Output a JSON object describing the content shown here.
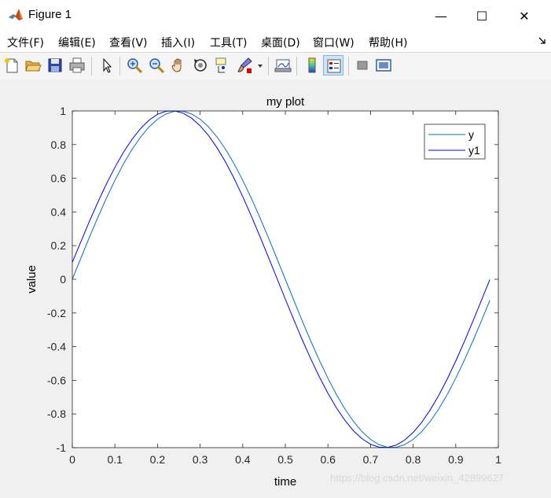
{
  "window": {
    "title": "Figure 1",
    "minimize_label": "—",
    "maximize_label": "☐",
    "close_label": "✕"
  },
  "menu": [
    {
      "label": "文件(F)"
    },
    {
      "label": "编辑(E)"
    },
    {
      "label": "查看(V)"
    },
    {
      "label": "插入(I)"
    },
    {
      "label": "工具(T)"
    },
    {
      "label": "桌面(D)"
    },
    {
      "label": "窗口(W)"
    },
    {
      "label": "帮助(H)"
    }
  ],
  "menu_overflow_icon": "dock-arrow-icon",
  "toolbar": [
    {
      "icon": "new-figure-icon"
    },
    {
      "icon": "open-file-icon"
    },
    {
      "icon": "save-icon"
    },
    {
      "icon": "print-icon"
    },
    {
      "icon": "pointer-icon"
    },
    {
      "icon": "zoom-in-icon"
    },
    {
      "icon": "zoom-out-icon"
    },
    {
      "icon": "pan-icon"
    },
    {
      "icon": "rotate-3d-icon"
    },
    {
      "icon": "data-cursor-icon"
    },
    {
      "icon": "brush-icon"
    },
    {
      "icon": "link-plot-icon"
    },
    {
      "icon": "colorbar-icon"
    },
    {
      "icon": "legend-icon"
    },
    {
      "icon": "hide-plot-tools-icon"
    },
    {
      "icon": "show-plot-tools-icon"
    }
  ],
  "watermark": "https://blog.csdn.net/weixin_42899627",
  "colors": {
    "y": "#0072BD",
    "y1": "#0000FF"
  },
  "chart_data": {
    "type": "line",
    "title": "my plot",
    "xlabel": "time",
    "ylabel": "value",
    "xlim": [
      0,
      1
    ],
    "ylim": [
      -1,
      1
    ],
    "xticks": [
      "0",
      "0.1",
      "0.2",
      "0.3",
      "0.4",
      "0.5",
      "0.6",
      "0.7",
      "0.8",
      "0.9",
      "1"
    ],
    "yticks": [
      "1",
      "0.8",
      "0.6",
      "0.4",
      "0.2",
      "0",
      "-0.2",
      "-0.4",
      "-0.6",
      "-0.8",
      "-1"
    ],
    "grid": false,
    "legend_position": "top-right",
    "x": [
      0,
      0.02,
      0.04,
      0.06,
      0.08,
      0.1,
      0.12,
      0.14,
      0.16,
      0.18,
      0.2,
      0.22,
      0.24,
      0.26,
      0.28,
      0.3,
      0.32,
      0.34,
      0.36,
      0.38,
      0.4,
      0.42,
      0.44,
      0.46,
      0.48,
      0.5,
      0.52,
      0.54,
      0.56,
      0.58,
      0.6,
      0.62,
      0.64,
      0.66,
      0.68,
      0.7,
      0.72,
      0.74,
      0.76,
      0.78,
      0.8,
      0.82,
      0.84,
      0.86,
      0.88,
      0.9,
      0.92,
      0.94,
      0.96,
      0.98
    ],
    "series": [
      {
        "name": "y",
        "values": [
          0,
          0.125,
          0.249,
          0.368,
          0.482,
          0.588,
          0.685,
          0.771,
          0.844,
          0.905,
          0.951,
          0.982,
          0.998,
          0.998,
          0.982,
          0.951,
          0.905,
          0.844,
          0.771,
          0.685,
          0.588,
          0.482,
          0.368,
          0.249,
          0.125,
          0,
          -0.125,
          -0.249,
          -0.368,
          -0.482,
          -0.588,
          -0.685,
          -0.771,
          -0.844,
          -0.905,
          -0.951,
          -0.982,
          -0.998,
          -0.998,
          -0.982,
          -0.951,
          -0.905,
          -0.844,
          -0.771,
          -0.685,
          -0.588,
          -0.482,
          -0.368,
          -0.249,
          -0.125
        ]
      },
      {
        "name": "y1",
        "values": [
          0.1,
          0.223,
          0.343,
          0.458,
          0.566,
          0.665,
          0.754,
          0.831,
          0.895,
          0.945,
          0.98,
          0.998,
          1.0,
          0.987,
          0.957,
          0.912,
          0.853,
          0.78,
          0.695,
          0.598,
          0.491,
          0.377,
          0.257,
          0.133,
          0.008,
          -0.118,
          -0.241,
          -0.361,
          -0.474,
          -0.58,
          -0.677,
          -0.764,
          -0.838,
          -0.9,
          -0.947,
          -0.98,
          -0.997,
          -0.999,
          -0.985,
          -0.955,
          -0.91,
          -0.85,
          -0.776,
          -0.69,
          -0.593,
          -0.486,
          -0.371,
          -0.251,
          -0.127,
          -0.002
        ]
      }
    ]
  }
}
